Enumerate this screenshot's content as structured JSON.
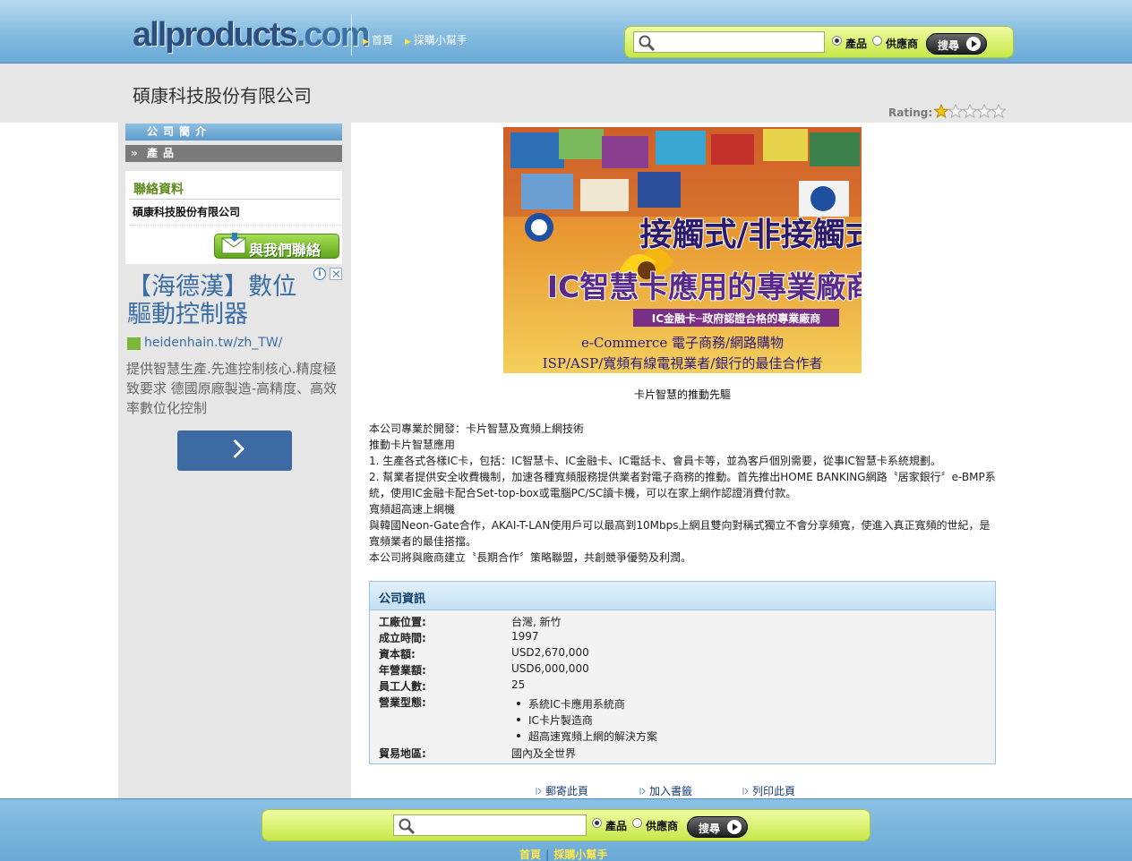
{
  "header": {
    "logo_main": "allproducts",
    "logo_tld": ".com",
    "nav": [
      "首頁",
      "採購小幫手"
    ],
    "search": {
      "placeholder": "",
      "options": [
        "產品",
        "供應商"
      ],
      "selected": "產品",
      "button_label": "搜尋"
    }
  },
  "company": {
    "title": "碩康科技股份有限公司",
    "rating_label": "Rating:",
    "rating_value": 1,
    "rating_max": 5
  },
  "sidebar": {
    "menu": [
      {
        "label": "公司簡介",
        "arrow": ""
      },
      {
        "label": "產品",
        "arrow": "»"
      }
    ],
    "contact": {
      "title": "聯絡資料",
      "name": "碩康科技股份有限公司",
      "button_label": "與我們聯絡"
    },
    "ad": {
      "title": "【海德漢】數位驅動控制器",
      "url": "heidenhain.tw/zh_TW/",
      "description": "提供智慧生產.先進控制核心.精度極致要求 德國原廠製造-高精度、高效率數位化控制"
    }
  },
  "banner": {
    "headline_1": "接觸式/非接觸式",
    "headline_2": "IC智慧卡應用的專業廠商",
    "tag": "IC金融卡─政府認證合格的專業廠商",
    "line_1": "e-Commerce 電子商務/網路購物",
    "line_2": "ISP/ASP/寬頻有線電視業者/銀行的最佳合作者",
    "caption": "卡片智慧的推動先驅"
  },
  "description": [
    "本公司專業於開發：卡片智慧及寬頻上網技術",
    "推動卡片智慧應用",
    "1. 生產各式各樣IC卡，包括：IC智慧卡、IC金融卡、IC電話卡、會員卡等，並為客戶個別需要，從事IC智慧卡系統規劃。",
    "2. 幫業者提供安全收費機制，加速各種寬頻服務提供業者對電子商務的推動。首先推出HOME BANKING網路〝居家銀行〞e-BMP系統，使用IC金融卡配合Set-top-box或電腦PC/SC讀卡機，可以在家上網作認證消費付款。",
    "寬頻超高速上網機",
    "與韓國Neon-Gate合作，AKAI-T-LAN使用戶可以最高到10Mbps上網且雙向對稱式獨立不會分享頻寬，使進入真正寬頻的世紀，是寬頻業者的最佳搭擋。",
    "本公司將與廠商建立〝長期合作〞策略聯盟，共創競爭優勢及利潤。"
  ],
  "info": {
    "title": "公司資訊",
    "rows": [
      {
        "label": "工廠位置:",
        "value": "台灣, 新竹"
      },
      {
        "label": "成立時間:",
        "value": "1997"
      },
      {
        "label": "資本額:",
        "value": "USD2,670,000"
      },
      {
        "label": "年營業額:",
        "value": "USD6,000,000"
      },
      {
        "label": "員工人數:",
        "value": "25"
      }
    ],
    "business_label": "營業型態:",
    "business_types": [
      "系統IC卡應用系統商",
      "IC卡片製造商",
      "超高速寬頻上網的解決方案"
    ],
    "region_label": "貿易地區:",
    "region_value": "國內及全世界"
  },
  "page_actions": [
    "郵寄此頁",
    "加入書籤",
    "列印此頁"
  ],
  "footer": {
    "search": {
      "placeholder": "",
      "options": [
        "產品",
        "供應商"
      ],
      "selected": "產品",
      "button_label": "搜尋"
    },
    "links": [
      "首頁",
      "採購小幫手"
    ]
  },
  "colors": {
    "header_blue": "#84bbe0",
    "search_green": "#c6e84a",
    "accent_green": "#5c8a1d",
    "link_blue": "#1a3f7a"
  }
}
